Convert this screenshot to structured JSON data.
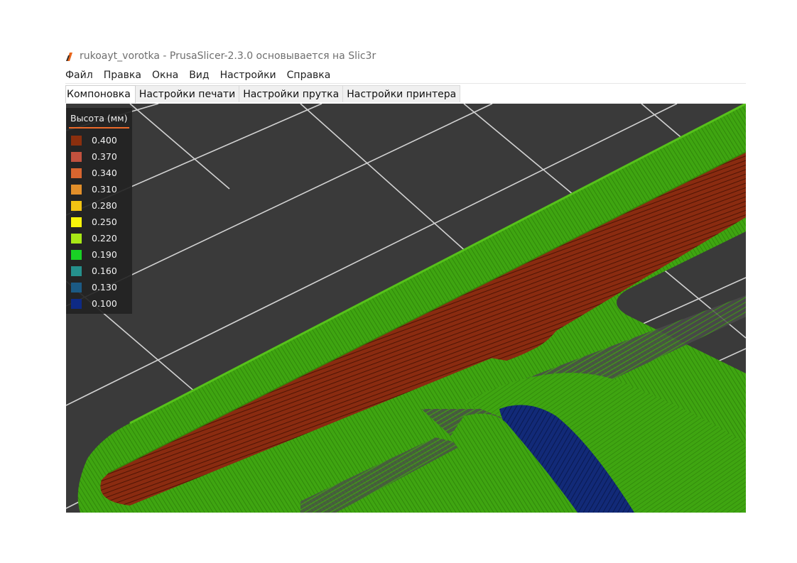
{
  "window": {
    "title": "rukoayt_vorotka - PrusaSlicer-2.3.0 основывается на Slic3r",
    "app_icon": "prusaslicer-logo"
  },
  "menu": [
    "Файл",
    "Правка",
    "Окна",
    "Вид",
    "Настройки",
    "Справка"
  ],
  "tabs": [
    {
      "label": "Компоновка",
      "active": true
    },
    {
      "label": "Настройки печати",
      "active": false
    },
    {
      "label": "Настройки прутка",
      "active": false
    },
    {
      "label": "Настройки принтера",
      "active": false
    }
  ],
  "legend": {
    "title": "Высота (мм)",
    "accent": "#ec6a2a",
    "items": [
      {
        "value": "0.400",
        "color": "#8b2f0e"
      },
      {
        "value": "0.370",
        "color": "#c2513e"
      },
      {
        "value": "0.340",
        "color": "#d8652f"
      },
      {
        "value": "0.310",
        "color": "#e28f2a"
      },
      {
        "value": "0.280",
        "color": "#f2c313"
      },
      {
        "value": "0.250",
        "color": "#f7f40a"
      },
      {
        "value": "0.220",
        "color": "#a8e816"
      },
      {
        "value": "0.190",
        "color": "#19d125"
      },
      {
        "value": "0.160",
        "color": "#25908c"
      },
      {
        "value": "0.130",
        "color": "#1b5a84"
      },
      {
        "value": "0.100",
        "color": "#0e2a85"
      }
    ]
  },
  "colors": {
    "bed": "#3a3a3a",
    "grid": "#d2d2d2",
    "model_green": "#3fa511",
    "model_red": "#8a2b10",
    "model_blue": "#122a78"
  }
}
